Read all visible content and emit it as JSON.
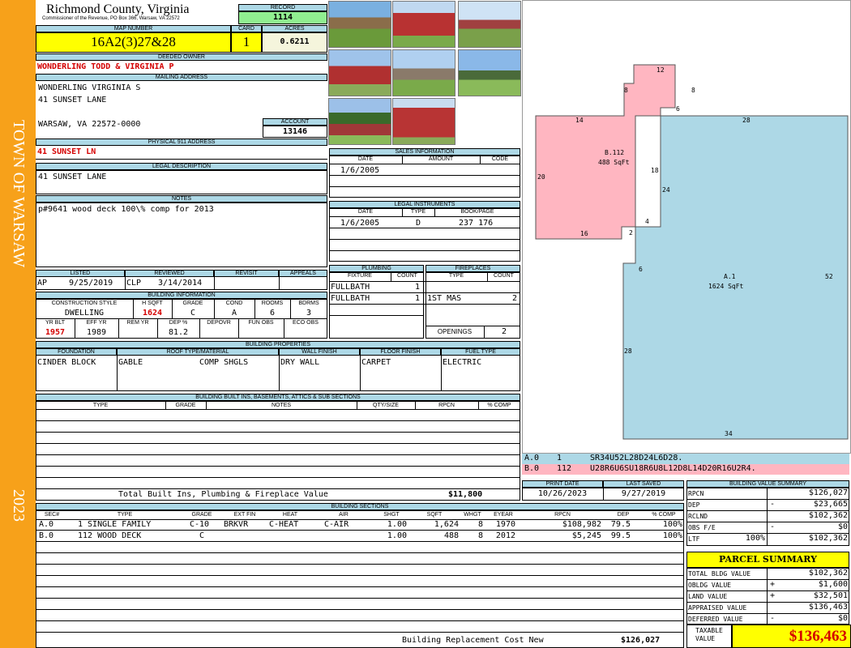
{
  "sidebar": {
    "town": "TOWN OF WARSAW",
    "year": "2023"
  },
  "header": {
    "county": "Richmond County, Virginia",
    "commissioner": "Commissioner of the Revenue, PO Box 366, Warsaw, VA 22572",
    "record_label": "RECORD",
    "record": "1114",
    "map_label": "MAP NUMBER",
    "map_number": "16A2(3)27&28",
    "card_label": "CARD",
    "card": "1",
    "acres_label": "ACRES",
    "acres": "0.6211"
  },
  "owner": {
    "label": "DEEDED OWNER",
    "name": "WONDERLING TODD & VIRGINIA P",
    "mail_label": "MAILING ADDRESS",
    "mail1": "WONDERLING VIRGINIA S",
    "mail2": "41 SUNSET LANE",
    "mail3": "WARSAW, VA 22572-0000",
    "account_label": "ACCOUNT",
    "account": "13146"
  },
  "physical": {
    "label": "PHYSICAL 911 ADDRESS",
    "value": "41 SUNSET LN"
  },
  "legal": {
    "label": "LEGAL DESCRIPTION",
    "value": "41 SUNSET LANE"
  },
  "notes": {
    "label": "NOTES",
    "value": "p#9641 wood deck 100\\% comp for 2013"
  },
  "sales": {
    "label": "SALES INFORMATION",
    "cols": [
      "DATE",
      "AMOUNT",
      "CODE"
    ],
    "rows": [
      [
        "1/6/2005",
        "",
        ""
      ]
    ]
  },
  "instruments": {
    "label": "LEGAL INSTRUMENTS",
    "cols": [
      "DATE",
      "TYPE",
      "BOOK/PAGE"
    ],
    "rows": [
      [
        "1/6/2005",
        "D",
        "237 176"
      ]
    ]
  },
  "review": {
    "listed_label": "LISTED",
    "reviewed_label": "REVIEWED",
    "revisit_label": "REVISIT",
    "appeals_label": "APPEALS",
    "listed_by": "AP",
    "listed": "9/25/2019",
    "reviewed_by": "CLP",
    "reviewed": "3/14/2014"
  },
  "building_info": {
    "label": "BUILDING INFORMATION",
    "cols": [
      "CONSTRUCTION STYLE",
      "H SQFT",
      "GRADE",
      "COND",
      "ROOMS",
      "BDRMS"
    ],
    "vals": [
      "DWELLING",
      "1624",
      "C",
      "A",
      "6",
      "3"
    ],
    "cols2": [
      "YR BLT",
      "EFF YR",
      "REM YR",
      "DEP %",
      "DEPOVR",
      "FUN OBS",
      "ECO OBS"
    ],
    "vals2": [
      "1957",
      "1989",
      "",
      "81.2",
      "",
      "",
      ""
    ]
  },
  "plumbing": {
    "label": "PLUMBING",
    "cols": [
      "FIXTURE",
      "COUNT"
    ],
    "rows": [
      [
        "FULLBATH",
        "1"
      ],
      [
        "FULLBATH",
        "1"
      ]
    ]
  },
  "fireplaces": {
    "label": "FIREPLACES",
    "cols": [
      "TYPE",
      "COUNT"
    ],
    "rows": [
      [
        "",
        ""
      ],
      [
        "1ST MAS",
        "2"
      ]
    ],
    "openings_label": "OPENINGS",
    "openings": "2"
  },
  "properties": {
    "label": "BUILDING PROPERTIES",
    "cols": [
      "FOUNDATION",
      "ROOF TYPE/MATERIAL",
      "WALL FINISH",
      "FLOOR FINISH",
      "FUEL TYPE"
    ],
    "vals": [
      "CINDER BLOCK",
      "GABLE",
      "DRY WALL",
      "CARPET",
      "ELECTRIC"
    ],
    "roof_material": "COMP SHGLS"
  },
  "builtins": {
    "label": "BUILDING BUILT INS, BASEMENTS, ATTICS & SUB SECTIONS",
    "cols": [
      "TYPE",
      "GRADE",
      "NOTES",
      "QTY/SIZE",
      "RPCN",
      "% COMP"
    ],
    "total_label": "Total Built Ins, Plumbing & Fireplace Value",
    "total": "$11,800"
  },
  "sketch": {
    "area_b_label": "B.112",
    "area_b_sqft": "488 SqFt",
    "area_a_label": "A.1",
    "area_a_sqft": "1624 SqFt",
    "dims": [
      "12",
      "8",
      "8",
      "6",
      "14",
      "28",
      "20",
      "18",
      "24",
      "4",
      "16",
      "2",
      "6",
      "52",
      "28",
      "34"
    ],
    "codes": [
      {
        "id": "A.0",
        "n": "1",
        "code": "SR34U52L28D24L6D28."
      },
      {
        "id": "B.0",
        "n": "112",
        "code": "U28R6U6SU18R6U8L12D8L14D20R16U2R4."
      }
    ],
    "colors": {
      "a": "#add8e6",
      "b": "#ffb6c1"
    }
  },
  "dates": {
    "print_label": "PRINT DATE",
    "print": "10/26/2023",
    "saved_label": "LAST SAVED",
    "saved": "9/27/2019"
  },
  "sections": {
    "label": "BUILDING SECTIONS",
    "cols": [
      "SEC#",
      "TYPE",
      "GRADE",
      "EXT FIN",
      "HEAT",
      "AIR",
      "SHGT",
      "SQFT",
      "WHGT",
      "EYEAR",
      "RPCN",
      "DEP",
      "% COMP"
    ],
    "rows": [
      [
        "A.0",
        "1 SINGLE FAMILY",
        "C-10",
        "BRKVR",
        "C-HEAT",
        "C-AIR",
        "1.00",
        "1,624",
        "8",
        "1970",
        "$108,982",
        "79.5",
        "100%"
      ],
      [
        "B.0",
        "112 WOOD DECK",
        "C",
        "",
        "",
        "",
        "1.00",
        "488",
        "8",
        "2012",
        "$5,245",
        "99.5",
        "100%"
      ]
    ],
    "replacement_label": "Building Replacement Cost New",
    "replacement": "$126,027"
  },
  "value_summary": {
    "label": "BUILDING VALUE SUMMARY",
    "rows": [
      {
        "k": "RPCN",
        "s": "",
        "v": "$126,027"
      },
      {
        "k": "DEP",
        "s": "-",
        "v": "$23,665"
      },
      {
        "k": "RCLND",
        "s": "",
        "v": "$102,362"
      },
      {
        "k": "OBS F/E",
        "s": "-",
        "v": "$0"
      },
      {
        "k": "LTF",
        "s": "100%",
        "v": "$102,362"
      }
    ]
  },
  "parcel": {
    "label": "PARCEL SUMMARY",
    "rows": [
      {
        "k": "TOTAL BLDG VALUE",
        "s": "",
        "v": "$102,362"
      },
      {
        "k": "OBLDG VALUE",
        "s": "+",
        "v": "$1,600"
      },
      {
        "k": "LAND VALUE",
        "s": "+",
        "v": "$32,501"
      },
      {
        "k": "APPRAISED VALUE",
        "s": "",
        "v": "$136,463"
      },
      {
        "k": "DEFERRED VALUE",
        "s": "-",
        "v": "$0"
      }
    ],
    "taxable_label1": "TAXABLE",
    "taxable_label2": "VALUE",
    "taxable": "$136,463"
  }
}
